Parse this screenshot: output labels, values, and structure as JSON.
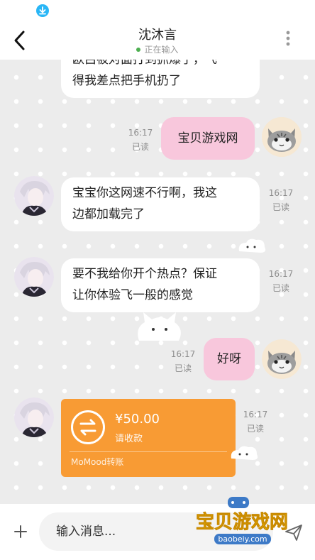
{
  "header": {
    "contact_name": "沈沐言",
    "status": "正在输入"
  },
  "messages": [
    {
      "side": "left",
      "text_line1": "欧吕被对面打到抓爆了，飞",
      "text_line2": "得我差点把手机扔了"
    },
    {
      "side": "right",
      "text": "宝贝游戏网",
      "time": "16:17",
      "read": "已读"
    },
    {
      "side": "left",
      "text_line1": "宝宝你这网速不行啊，我这",
      "text_line2": "边都加载完了",
      "time": "16:17",
      "read": "已读"
    },
    {
      "side": "left",
      "text_line1": "要不我给你开个热点？保证",
      "text_line2": "让你体验飞一般的感觉",
      "time": "16:17",
      "read": "已读"
    },
    {
      "side": "right",
      "text": "好呀",
      "time": "16:17",
      "read": "已读"
    }
  ],
  "transfer": {
    "amount": "¥50.00",
    "label": "请收款",
    "brand": "MoMood转账",
    "time": "16:17",
    "read": "已读"
  },
  "input": {
    "placeholder": "输入消息..."
  },
  "watermark": {
    "title": "宝贝游戏网",
    "url": "baobeiy.com"
  },
  "colors": {
    "my_bubble": "#f8c7dc",
    "their_bubble": "#ffffff",
    "transfer": "#f89b34",
    "online_dot": "#4caf50"
  },
  "icons": [
    "download-icon",
    "back-icon",
    "more-icon",
    "plus-icon",
    "send-icon",
    "transfer-arrows-icon"
  ]
}
